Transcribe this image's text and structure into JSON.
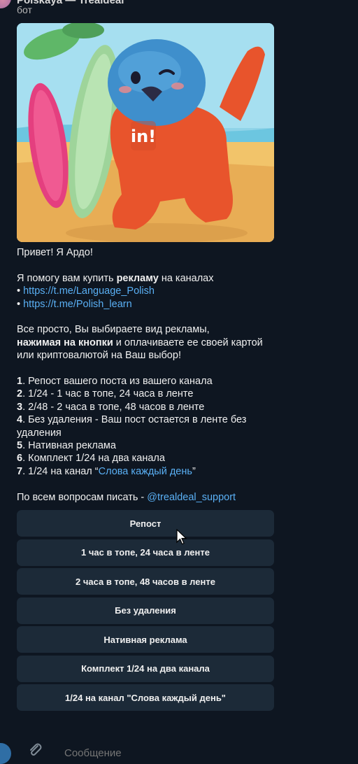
{
  "header": {
    "title": "Polskaya — Trealdeal",
    "subtitle": "бот"
  },
  "message": {
    "greeting": "Привет! Я Ардо!",
    "intro_before": "Я помогу вам купить ",
    "intro_bold": "рекламу",
    "intro_after": " на каналах",
    "links": [
      {
        "bullet": "• ",
        "url": "https://t.me/Language_Polish"
      },
      {
        "bullet": "• ",
        "url": "https://t.me/Polish_learn"
      }
    ],
    "explain_1": "Все просто, Вы выбираете вид рекламы,",
    "explain_bold": "нажимая на кнопки",
    "explain_2": " и оплачиваете ее своей картой или криптовалютой на Ваш выбор!",
    "list": [
      {
        "num": "1",
        "text": ". Репост вашего поста из вашего канала"
      },
      {
        "num": "2",
        "text": ". 1/24 - 1 час в топе, 24 часа в ленте"
      },
      {
        "num": "3",
        "text": ". 2/48 - 2 часа в топе, 48 часов в ленте"
      },
      {
        "num": "4",
        "text": ". Без удаления - Ваш пост остается в ленте без удаления"
      },
      {
        "num": "5",
        "text": ". Нативная реклама"
      },
      {
        "num": "6",
        "text": ". Комплект 1/24 на два канала"
      },
      {
        "num": "7",
        "text": ". 1/24 на канал “",
        "link": "Слова каждый день",
        "tail": "”"
      }
    ],
    "support_text": "По всем вопросам писать - ",
    "support_link": "@trealdeal_support"
  },
  "keyboard": [
    "Репост",
    "1 час в топе, 24 часа в ленте",
    "2 часа в топе, 48 часов в ленте",
    "Без удаления",
    "Нативная реклама",
    "Комплект 1/24 на два канала",
    "1/24 на канал \"Слова каждый день\""
  ],
  "composer": {
    "placeholder": "Сообщение"
  },
  "colors": {
    "background": "#0e1621",
    "link": "#5ab0f5",
    "button": "#1c2a38",
    "mascot_body": "#e8542c",
    "mascot_head": "#3f8fcc"
  }
}
